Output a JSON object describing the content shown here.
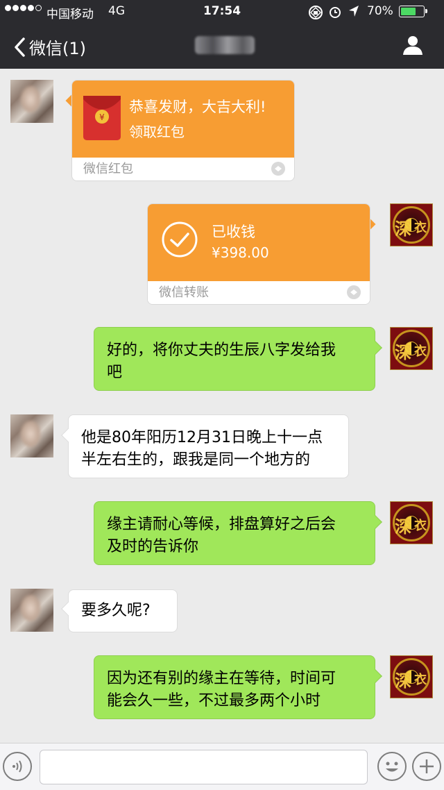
{
  "status_bar": {
    "carrier": "中国移动",
    "network": "4G",
    "time": "17:54",
    "battery_percent": "70%",
    "battery_level": 0.7,
    "icons": [
      "signal-dots-icon",
      "rotation-lock-icon",
      "alarm-icon",
      "location-arrow-icon",
      "battery-icon"
    ]
  },
  "navbar": {
    "back_label": "微信(1)",
    "chat_title": "",
    "icons": [
      "back-chevron-icon",
      "person-profile-icon"
    ]
  },
  "messages": [
    {
      "type": "red-packet",
      "side": "left",
      "title": "恭喜发财，大吉大利!",
      "subtitle": "领取红包",
      "footer": "微信红包",
      "icon": "red-envelope-icon"
    },
    {
      "type": "transfer",
      "side": "right",
      "title": "已收钱",
      "amount": "¥398.00",
      "footer": "微信转账",
      "icon": "checkmark-circle-icon"
    },
    {
      "type": "text",
      "side": "right",
      "lines": [
        "好的，将你丈夫的生辰八字发给我",
        "吧"
      ]
    },
    {
      "type": "text",
      "side": "left",
      "lines": [
        "他是80年阳历12月31日晚上十一点",
        "半左右生的，跟我是同一个地方的"
      ]
    },
    {
      "type": "text",
      "side": "right",
      "lines": [
        "缘主请耐心等候，排盘算好之后会",
        "及时的告诉你"
      ]
    },
    {
      "type": "text",
      "side": "left",
      "lines": [
        "要多久呢?"
      ]
    },
    {
      "type": "text",
      "side": "right",
      "lines": [
        "因为还有别的缘主在等待，时间可",
        "能会久一些，不过最多两个小时"
      ]
    }
  ],
  "master_avatar_glyph": {
    "left": "深",
    "right": "衣"
  },
  "input_bar": {
    "value": "",
    "placeholder": "",
    "icons": [
      "voice-icon",
      "emoji-icon",
      "plus-icon"
    ]
  },
  "colors": {
    "header_bg": "#2b2b2f",
    "chat_bg": "#ebebeb",
    "green_bubble": "#a0e75a",
    "orange_card": "#f79d33",
    "battery_green": "#4cd964"
  }
}
